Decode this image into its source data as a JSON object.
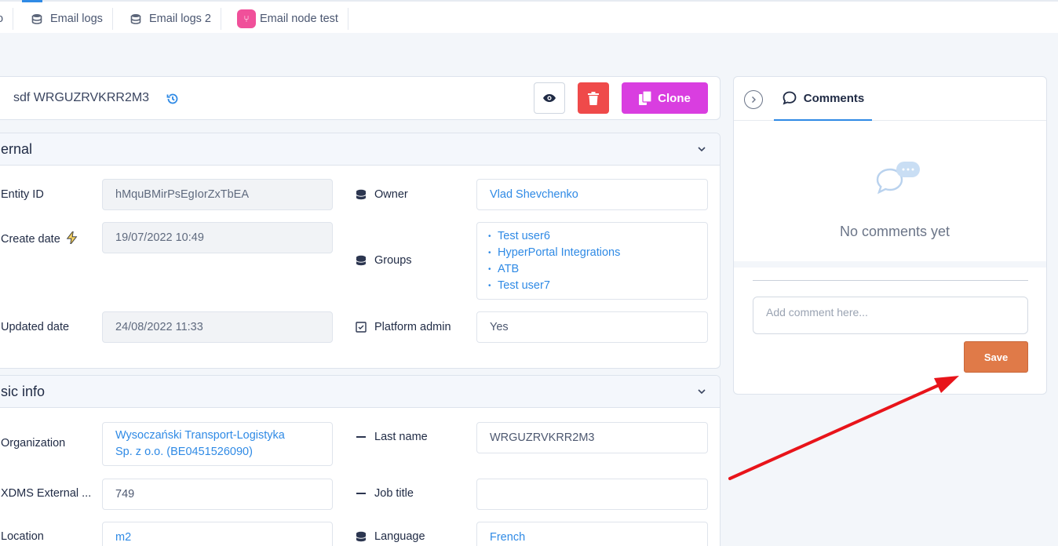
{
  "tabs": [
    {
      "label": "o"
    },
    {
      "label": "Email logs"
    },
    {
      "label": "Email logs 2"
    },
    {
      "label": "Email node test"
    }
  ],
  "header": {
    "title": "sdf WRGUZRVKRR2M3",
    "clone_label": "Clone"
  },
  "sections": {
    "internal": {
      "title": "ernal",
      "entity_id_label": "Entity ID",
      "entity_id_value": "hMquBMirPsEgIorZxTbEA",
      "create_date_label": "Create date",
      "create_date_value": "19/07/2022 10:49",
      "updated_date_label": "Updated date",
      "updated_date_value": "24/08/2022 11:33",
      "owner_label": "Owner",
      "owner_value": "Vlad Shevchenko",
      "groups_label": "Groups",
      "groups": [
        "Test user6",
        "HyperPortal Integrations",
        "ATB",
        "Test user7"
      ],
      "platform_admin_label": "Platform admin",
      "platform_admin_value": "Yes"
    },
    "basic": {
      "title": "sic info",
      "organization_label": "Organization",
      "organization_line1": "Wysoczański Transport-Logistyka",
      "organization_line2": "Sp. z o.o. (BE0451526090)",
      "xdms_label": "XDMS External ...",
      "xdms_value": "749",
      "location_label": "Location",
      "location_value": "m2",
      "last_name_label": "Last name",
      "last_name_value": "WRGUZRVKRR2M3",
      "job_title_label": "Job title",
      "job_title_value": "",
      "language_label": "Language",
      "language_value": "French"
    }
  },
  "comments": {
    "tab_label": "Comments",
    "empty_text": "No comments yet",
    "input_placeholder": "Add comment here...",
    "save_label": "Save"
  },
  "colors": {
    "accent_blue": "#2f8ae5",
    "clone_magenta": "#d93ee0",
    "delete_red": "#ef4a4a",
    "save_orange": "#e07a48",
    "annotation_arrow": "#e8141a"
  }
}
